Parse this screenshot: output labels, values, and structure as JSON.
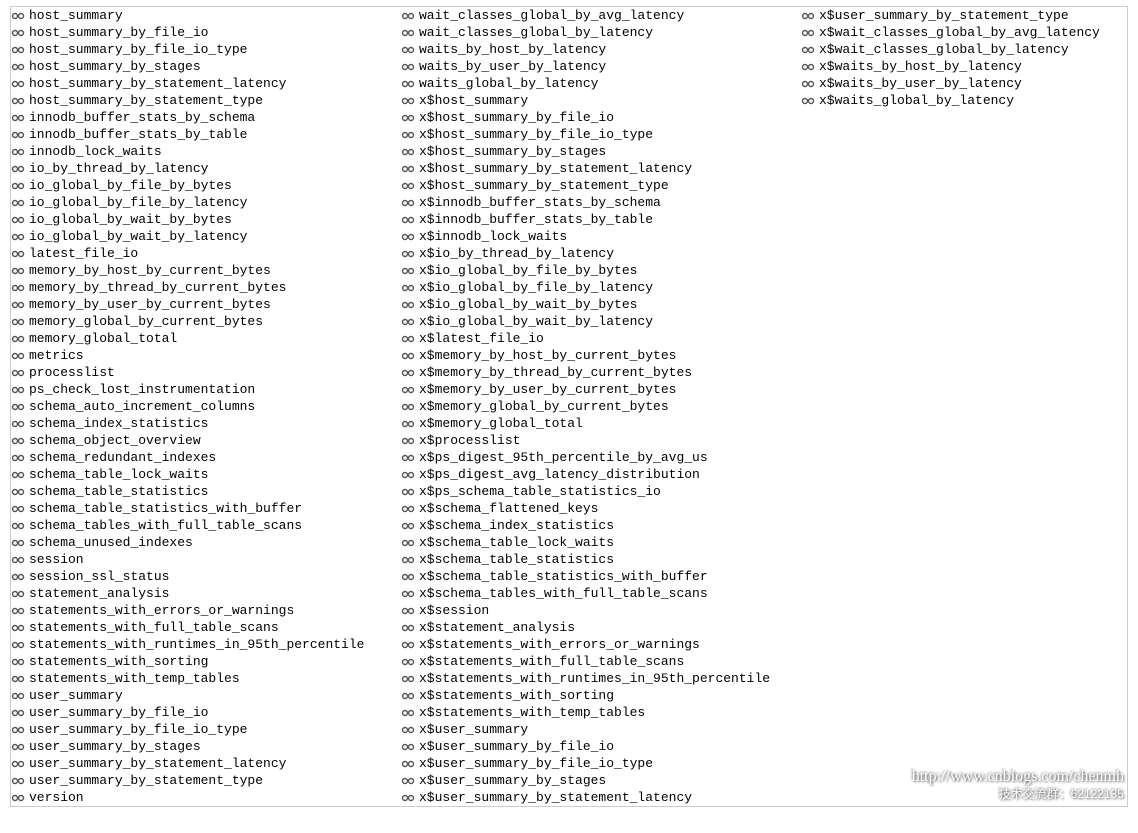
{
  "watermark": {
    "url": "http://www.cnblogs.com/chenmh",
    "group": "技术交流群：62122135"
  },
  "columns": {
    "col1": [
      "host_summary",
      "host_summary_by_file_io",
      "host_summary_by_file_io_type",
      "host_summary_by_stages",
      "host_summary_by_statement_latency",
      "host_summary_by_statement_type",
      "innodb_buffer_stats_by_schema",
      "innodb_buffer_stats_by_table",
      "innodb_lock_waits",
      "io_by_thread_by_latency",
      "io_global_by_file_by_bytes",
      "io_global_by_file_by_latency",
      "io_global_by_wait_by_bytes",
      "io_global_by_wait_by_latency",
      "latest_file_io",
      "memory_by_host_by_current_bytes",
      "memory_by_thread_by_current_bytes",
      "memory_by_user_by_current_bytes",
      "memory_global_by_current_bytes",
      "memory_global_total",
      "metrics",
      "processlist",
      "ps_check_lost_instrumentation",
      "schema_auto_increment_columns",
      "schema_index_statistics",
      "schema_object_overview",
      "schema_redundant_indexes",
      "schema_table_lock_waits",
      "schema_table_statistics",
      "schema_table_statistics_with_buffer",
      "schema_tables_with_full_table_scans",
      "schema_unused_indexes",
      "session",
      "session_ssl_status",
      "statement_analysis",
      "statements_with_errors_or_warnings",
      "statements_with_full_table_scans",
      "statements_with_runtimes_in_95th_percentile",
      "statements_with_sorting",
      "statements_with_temp_tables",
      "user_summary",
      "user_summary_by_file_io",
      "user_summary_by_file_io_type",
      "user_summary_by_stages",
      "user_summary_by_statement_latency",
      "user_summary_by_statement_type",
      "version"
    ],
    "col2": [
      "wait_classes_global_by_avg_latency",
      "wait_classes_global_by_latency",
      "waits_by_host_by_latency",
      "waits_by_user_by_latency",
      "waits_global_by_latency",
      "x$host_summary",
      "x$host_summary_by_file_io",
      "x$host_summary_by_file_io_type",
      "x$host_summary_by_stages",
      "x$host_summary_by_statement_latency",
      "x$host_summary_by_statement_type",
      "x$innodb_buffer_stats_by_schema",
      "x$innodb_buffer_stats_by_table",
      "x$innodb_lock_waits",
      "x$io_by_thread_by_latency",
      "x$io_global_by_file_by_bytes",
      "x$io_global_by_file_by_latency",
      "x$io_global_by_wait_by_bytes",
      "x$io_global_by_wait_by_latency",
      "x$latest_file_io",
      "x$memory_by_host_by_current_bytes",
      "x$memory_by_thread_by_current_bytes",
      "x$memory_by_user_by_current_bytes",
      "x$memory_global_by_current_bytes",
      "x$memory_global_total",
      "x$processlist",
      "x$ps_digest_95th_percentile_by_avg_us",
      "x$ps_digest_avg_latency_distribution",
      "x$ps_schema_table_statistics_io",
      "x$schema_flattened_keys",
      "x$schema_index_statistics",
      "x$schema_table_lock_waits",
      "x$schema_table_statistics",
      "x$schema_table_statistics_with_buffer",
      "x$schema_tables_with_full_table_scans",
      "x$session",
      "x$statement_analysis",
      "x$statements_with_errors_or_warnings",
      "x$statements_with_full_table_scans",
      "x$statements_with_runtimes_in_95th_percentile",
      "x$statements_with_sorting",
      "x$statements_with_temp_tables",
      "x$user_summary",
      "x$user_summary_by_file_io",
      "x$user_summary_by_file_io_type",
      "x$user_summary_by_stages",
      "x$user_summary_by_statement_latency"
    ],
    "col3": [
      "x$user_summary_by_statement_type",
      "x$wait_classes_global_by_avg_latency",
      "x$wait_classes_global_by_latency",
      "x$waits_by_host_by_latency",
      "x$waits_by_user_by_latency",
      "x$waits_global_by_latency"
    ]
  }
}
